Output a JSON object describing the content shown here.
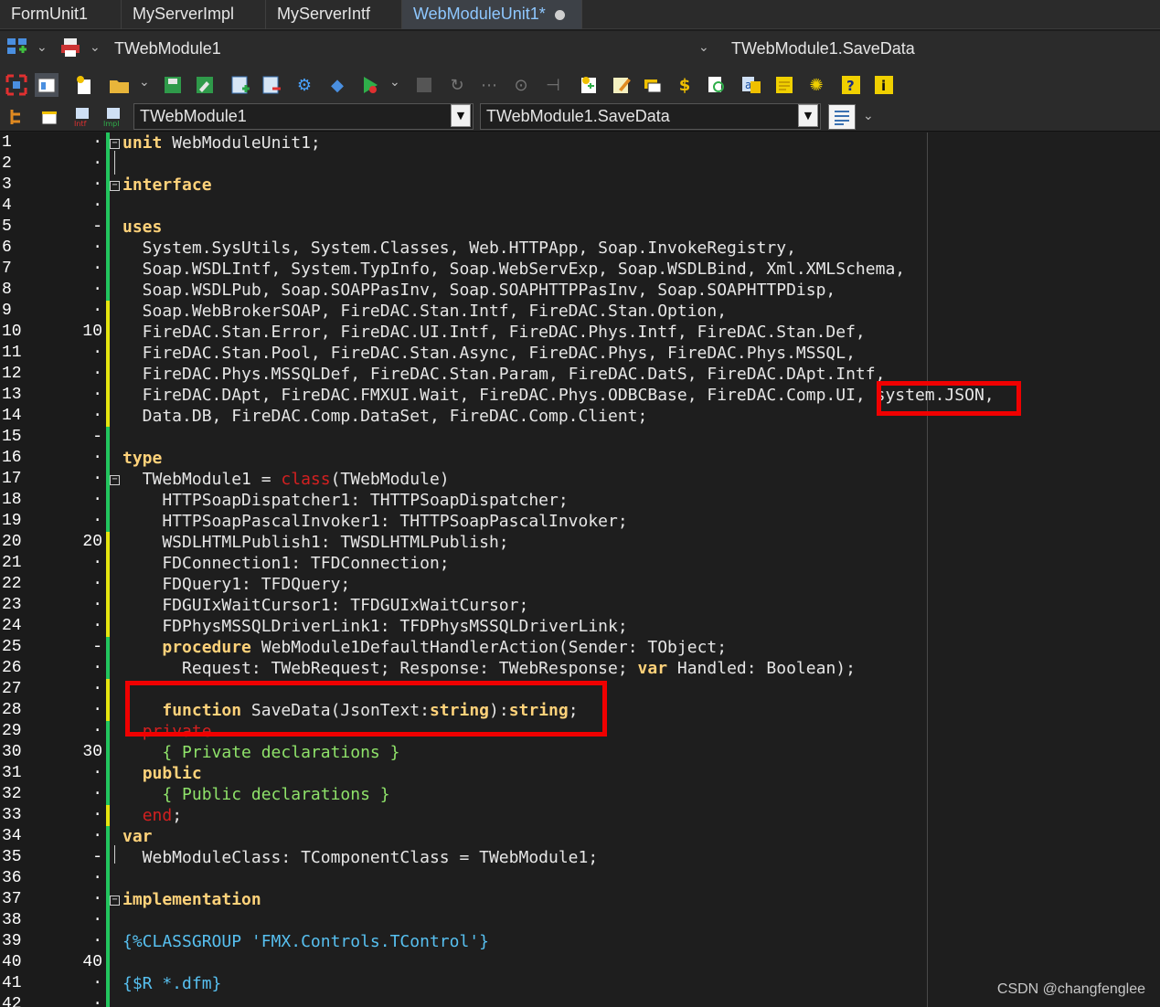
{
  "tabs": [
    {
      "label": "FormUnit1",
      "active": false
    },
    {
      "label": "MyServerImpl",
      "active": false
    },
    {
      "label": "MyServerIntf",
      "active": false
    },
    {
      "label": "WebModuleUnit1*",
      "active": true
    }
  ],
  "nav": {
    "class_label": "TWebModule1",
    "method_label": "TWebModule1.SaveData"
  },
  "selector": {
    "class_value": "TWebModule1",
    "method_value": "TWebModule1.SaveData"
  },
  "toolbar_icons": [
    "fullscreen-icon",
    "form-icon",
    "new-item-icon",
    "open-folder-icon",
    "save-icon",
    "save-all-icon",
    "add-file-icon",
    "remove-file-icon",
    "options-icon",
    "deploy-icon",
    "run-icon",
    "stop-icon",
    "step-over-icon",
    "trace-into-icon",
    "pause-icon",
    "run-to-cursor-icon",
    "new-unit-icon",
    "edit-icon",
    "copy-icon",
    "dollar-icon",
    "find-icon",
    "translate-icon",
    "notes-icon",
    "gear-icon",
    "help-icon",
    "info-icon"
  ],
  "editor": {
    "lines": [
      {
        "n": "1",
        "m": "·",
        "code": "unit WebModuleUnit1;"
      },
      {
        "n": "2",
        "m": "·",
        "code": ""
      },
      {
        "n": "3",
        "m": "·",
        "code": "interface"
      },
      {
        "n": "4",
        "m": "·",
        "code": ""
      },
      {
        "n": "5",
        "m": "-",
        "code": "uses"
      },
      {
        "n": "6",
        "m": "·",
        "code": "  System.SysUtils, System.Classes, Web.HTTPApp, Soap.InvokeRegistry,"
      },
      {
        "n": "7",
        "m": "·",
        "code": "  Soap.WSDLIntf, System.TypInfo, Soap.WebServExp, Soap.WSDLBind, Xml.XMLSchema,"
      },
      {
        "n": "8",
        "m": "·",
        "code": "  Soap.WSDLPub, Soap.SOAPPasInv, Soap.SOAPHTTPPasInv, Soap.SOAPHTTPDisp,"
      },
      {
        "n": "9",
        "m": "·",
        "code": "  Soap.WebBrokerSOAP, FireDAC.Stan.Intf, FireDAC.Stan.Option,"
      },
      {
        "n": "10",
        "m": "10",
        "code": "  FireDAC.Stan.Error, FireDAC.UI.Intf, FireDAC.Phys.Intf, FireDAC.Stan.Def,"
      },
      {
        "n": "11",
        "m": "·",
        "code": "  FireDAC.Stan.Pool, FireDAC.Stan.Async, FireDAC.Phys, FireDAC.Phys.MSSQL,"
      },
      {
        "n": "12",
        "m": "·",
        "code": "  FireDAC.Phys.MSSQLDef, FireDAC.Stan.Param, FireDAC.DatS, FireDAC.DApt.Intf,"
      },
      {
        "n": "13",
        "m": "·",
        "code": "  FireDAC.DApt, FireDAC.FMXUI.Wait, FireDAC.Phys.ODBCBase, FireDAC.Comp.UI, system.JSON,"
      },
      {
        "n": "14",
        "m": "·",
        "code": "  Data.DB, FireDAC.Comp.DataSet, FireDAC.Comp.Client;"
      },
      {
        "n": "15",
        "m": "-",
        "code": ""
      },
      {
        "n": "16",
        "m": "·",
        "code": "type"
      },
      {
        "n": "17",
        "m": "·",
        "code": "  TWebModule1 = class(TWebModule)"
      },
      {
        "n": "18",
        "m": "·",
        "code": "    HTTPSoapDispatcher1: THTTPSoapDispatcher;"
      },
      {
        "n": "19",
        "m": "·",
        "code": "    HTTPSoapPascalInvoker1: THTTPSoapPascalInvoker;"
      },
      {
        "n": "20",
        "m": "20",
        "code": "    WSDLHTMLPublish1: TWSDLHTMLPublish;"
      },
      {
        "n": "21",
        "m": "·",
        "code": "    FDConnection1: TFDConnection;"
      },
      {
        "n": "22",
        "m": "·",
        "code": "    FDQuery1: TFDQuery;"
      },
      {
        "n": "23",
        "m": "·",
        "code": "    FDGUIxWaitCursor1: TFDGUIxWaitCursor;"
      },
      {
        "n": "24",
        "m": "·",
        "code": "    FDPhysMSSQLDriverLink1: TFDPhysMSSQLDriverLink;"
      },
      {
        "n": "25",
        "m": "-",
        "code": "    procedure WebModule1DefaultHandlerAction(Sender: TObject;"
      },
      {
        "n": "26",
        "m": "·",
        "code": "      Request: TWebRequest; Response: TWebResponse; var Handled: Boolean);"
      },
      {
        "n": "27",
        "m": "·",
        "code": ""
      },
      {
        "n": "28",
        "m": "·",
        "code": "    function SaveData(JsonText:string):string;"
      },
      {
        "n": "29",
        "m": "·",
        "code": "  private"
      },
      {
        "n": "30",
        "m": "30",
        "code": "    { Private declarations }"
      },
      {
        "n": "31",
        "m": "·",
        "code": "  public"
      },
      {
        "n": "32",
        "m": "·",
        "code": "    { Public declarations }"
      },
      {
        "n": "33",
        "m": "·",
        "code": "  end;"
      },
      {
        "n": "34",
        "m": "·",
        "code": "var"
      },
      {
        "n": "35",
        "m": "-",
        "code": "  WebModuleClass: TComponentClass = TWebModule1;"
      },
      {
        "n": "36",
        "m": "·",
        "code": ""
      },
      {
        "n": "37",
        "m": "·",
        "code": "implementation"
      },
      {
        "n": "38",
        "m": "·",
        "code": ""
      },
      {
        "n": "39",
        "m": "·",
        "code": "{%CLASSGROUP 'FMX.Controls.TControl'}"
      },
      {
        "n": "40",
        "m": "40",
        "code": ""
      },
      {
        "n": "41",
        "m": "·",
        "code": "{$R *.dfm}"
      },
      {
        "n": "42",
        "m": "·",
        "code": ""
      }
    ]
  },
  "watermark": "CSDN @changfenglee",
  "colors": {
    "keyword": "#ffd27a",
    "comment": "#8fe36a",
    "directive": "#57c0f0",
    "highlight_box": "#f00000",
    "active_tab_text": "#8ec7ff"
  }
}
